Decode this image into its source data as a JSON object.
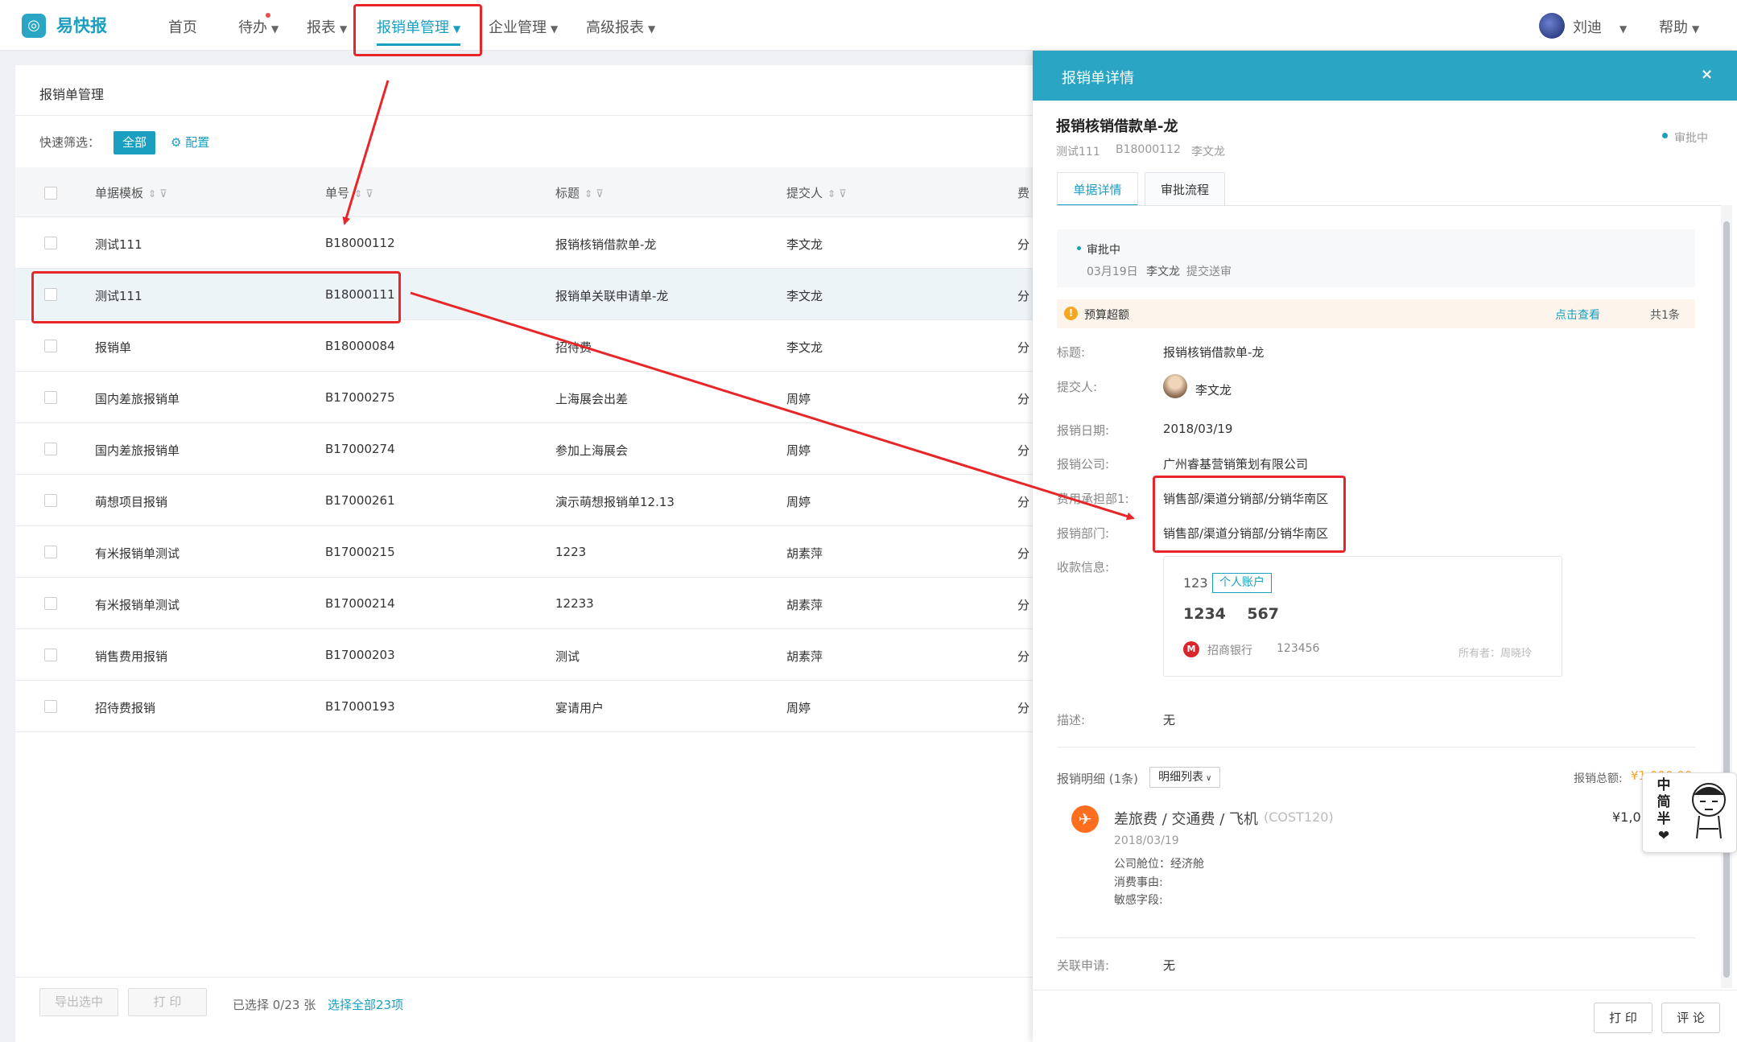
{
  "app": {
    "logo_text": "易快报",
    "logo_glyph": "◎",
    "brand_color": "#1a9fc0",
    "accent_color": "#2aa6c4",
    "highlight_color": "#e8262a"
  },
  "nav": {
    "items": [
      {
        "label": "首页"
      },
      {
        "label": "待办"
      },
      {
        "label": "报表"
      },
      {
        "label": "报销单管理"
      },
      {
        "label": "企业管理"
      },
      {
        "label": "高级报表"
      }
    ],
    "user_name": "刘迪",
    "help_label": "帮助"
  },
  "list": {
    "card_title": "报销单管理",
    "filter_label": "快速筛选：",
    "filter_all": "全部",
    "config_label": "配置",
    "columns": [
      "单据模板",
      "单号",
      "标题",
      "提交人",
      "费"
    ],
    "rows": [
      {
        "template": "测试111",
        "number": "B18000112",
        "title": "报销核销借款单-龙",
        "submitter": "李文龙",
        "fee": "分"
      },
      {
        "template": "测试111",
        "number": "B18000111",
        "title": "报销单关联申请单-龙",
        "submitter": "李文龙",
        "fee": "分"
      },
      {
        "template": "报销单",
        "number": "B18000084",
        "title": "招待费",
        "submitter": "李文龙",
        "fee": "分"
      },
      {
        "template": "国内差旅报销单",
        "number": "B17000275",
        "title": "上海展会出差",
        "submitter": "周婷",
        "fee": "分"
      },
      {
        "template": "国内差旅报销单",
        "number": "B17000274",
        "title": "参加上海展会",
        "submitter": "周婷",
        "fee": "分"
      },
      {
        "template": "萌想项目报销",
        "number": "B17000261",
        "title": "演示萌想报销单12.13",
        "submitter": "周婷",
        "fee": "分"
      },
      {
        "template": "有米报销单测试",
        "number": "B17000215",
        "title": "1223",
        "submitter": "胡素萍",
        "fee": "分"
      },
      {
        "template": "有米报销单测试",
        "number": "B17000214",
        "title": "12233",
        "submitter": "胡素萍",
        "fee": "分"
      },
      {
        "template": "销售费用报销",
        "number": "B17000203",
        "title": "测试",
        "submitter": "胡素萍",
        "fee": "分"
      },
      {
        "template": "招待费报销",
        "number": "B17000193",
        "title": "宴请用户",
        "submitter": "周婷",
        "fee": "分"
      }
    ],
    "export_label": "导出选中",
    "print_label": "打 印",
    "selected_text": "已选择 0/23 张",
    "select_all_label": "选择全部23项"
  },
  "detail": {
    "header_title": "报销单详情",
    "close_glyph": "×",
    "title": "报销核销借款单-龙",
    "sub_template": "测试111",
    "sub_number": "B18000112",
    "sub_submitter": "李文龙",
    "status": "审批中",
    "tab_detail": "单据详情",
    "tab_flow": "审批流程",
    "approval_status": "审批中",
    "approval_date": "03月19日",
    "approval_user": "李文龙",
    "approval_action": "提交送审",
    "budget_warning": "预算超额",
    "budget_link": "点击查看",
    "budget_count": "共1条",
    "fields": {
      "title_label": "标题:",
      "title_value": "报销核销借款单-龙",
      "submitter_label": "提交人:",
      "submitter_value": "李文龙",
      "date_label": "报销日期:",
      "date_value": "2018/03/19",
      "company_label": "报销公司:",
      "company_value": "广州睿基营销策划有限公司",
      "cost_dept_label": "费用承担部1:",
      "cost_dept_value": "销售部/渠道分销部/分销华南区",
      "dept_label": "报销部门:",
      "dept_value": "销售部/渠道分销部/分销华南区",
      "payee_label": "收款信息:",
      "desc_label": "描述:",
      "desc_value": "无",
      "related_label": "关联申请:",
      "related_value": "无"
    },
    "payee": {
      "name": "123",
      "account_type": "个人账户",
      "account_number": "1234    567",
      "bank_name": "招商银行",
      "bank_code": "123456",
      "owner": "所有者：周晓玲"
    },
    "items_label": "报销明细 (1条)",
    "items_view": "明细列表",
    "total_label": "报销总额:",
    "total_value": "¥1,000.00",
    "item": {
      "category": "差旅费 / 交通费 / 飞机",
      "code": "(COST120)",
      "amount": "¥1,0",
      "date": "2018/03/19",
      "cabin": "公司舱位：经济舱",
      "reason": "消费事由:",
      "sensitive": "敏感字段:"
    },
    "footer_print": "打 印",
    "footer_comment": "评 论"
  },
  "ime_widget": {
    "chars": [
      "中",
      "简",
      "半",
      "❤"
    ]
  }
}
